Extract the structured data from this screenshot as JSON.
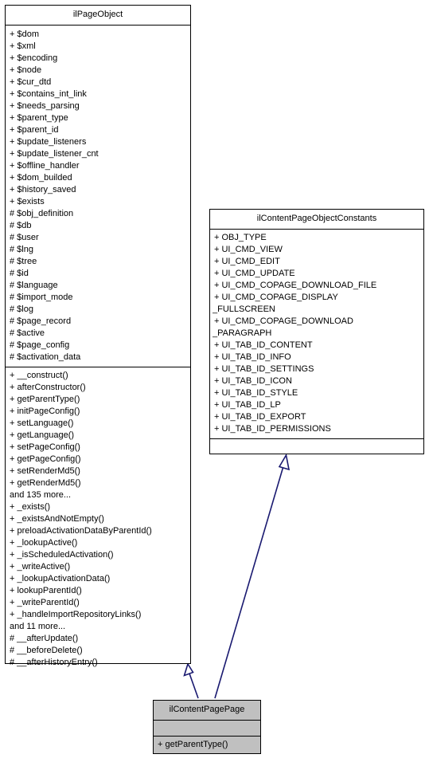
{
  "diagram": {
    "type": "uml-class-diagram",
    "background": "#ffffff",
    "edge_color": "#191970",
    "filled_class_color": "#c0c0c0"
  },
  "classes": {
    "ilPageObject": {
      "name": "ilPageObject",
      "attributes": [
        "+ $dom",
        "+ $xml",
        "+ $encoding",
        "+ $node",
        "+ $cur_dtd",
        "+ $contains_int_link",
        "+ $needs_parsing",
        "+ $parent_type",
        "+ $parent_id",
        "+ $update_listeners",
        "+ $update_listener_cnt",
        "+ $offline_handler",
        "+ $dom_builded",
        "+ $history_saved",
        "+ $exists",
        "# $obj_definition",
        "# $db",
        "# $user",
        "# $lng",
        "# $tree",
        "# $id",
        "# $language",
        "# $import_mode",
        "# $log",
        "# $page_record",
        "# $active",
        "# $page_config",
        "# $activation_data"
      ],
      "methods": [
        "+ __construct()",
        "+ afterConstructor()",
        "+ getParentType()",
        "+ initPageConfig()",
        "+ setLanguage()",
        "+ getLanguage()",
        "+ setPageConfig()",
        "+ getPageConfig()",
        "+ setRenderMd5()",
        "+ getRenderMd5()",
        "and 135 more...",
        "+ _exists()",
        "+ _existsAndNotEmpty()",
        "+ preloadActivationDataByParentId()",
        "+ _lookupActive()",
        "+ _isScheduledActivation()",
        "+ _writeActive()",
        "+ _lookupActivationData()",
        "+ lookupParentId()",
        "+ _writeParentId()",
        "+ _handleImportRepositoryLinks()",
        "and 11 more...",
        "# __afterUpdate()",
        "# __beforeDelete()",
        "# __afterHistoryEntry()"
      ]
    },
    "ilContentPageObjectConstants": {
      "name": "ilContentPageObjectConstants",
      "attributes": [
        "+ OBJ_TYPE",
        "+ UI_CMD_VIEW",
        "+ UI_CMD_EDIT",
        "+ UI_CMD_UPDATE",
        "+ UI_CMD_COPAGE_DOWNLOAD_FILE",
        "+ UI_CMD_COPAGE_DISPLAY",
        "_FULLSCREEN",
        "+ UI_CMD_COPAGE_DOWNLOAD",
        "_PARAGRAPH",
        "+ UI_TAB_ID_CONTENT",
        "+ UI_TAB_ID_INFO",
        "+ UI_TAB_ID_SETTINGS",
        "+ UI_TAB_ID_ICON",
        "+ UI_TAB_ID_STYLE",
        "+ UI_TAB_ID_LP",
        "+ UI_TAB_ID_EXPORT",
        "+ UI_TAB_ID_PERMISSIONS"
      ],
      "methods": []
    },
    "ilContentPagePage": {
      "name": "ilContentPagePage",
      "attributes": [],
      "methods": [
        "+ getParentType()"
      ]
    }
  },
  "relationships": [
    {
      "kind": "generalization",
      "from": "ilContentPagePage",
      "to": "ilPageObject"
    },
    {
      "kind": "generalization",
      "from": "ilContentPagePage",
      "to": "ilContentPageObjectConstants"
    }
  ]
}
